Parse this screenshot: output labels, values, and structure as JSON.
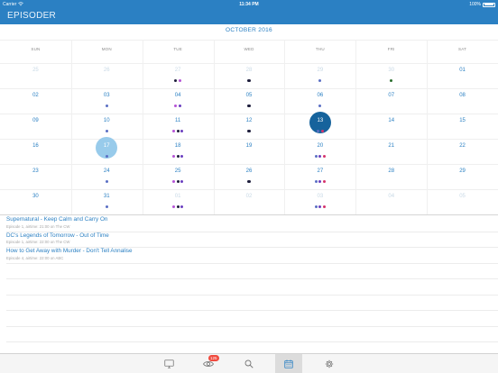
{
  "status_bar": {
    "carrier": "Carrier",
    "time": "11:34 PM",
    "battery": "100%"
  },
  "nav": {
    "title": "EPISODER"
  },
  "calendar": {
    "month_title": "OCTOBER 2016",
    "weekdays": [
      "SUN",
      "MON",
      "TUE",
      "WED",
      "THU",
      "FRI",
      "SAT"
    ],
    "weeks": [
      [
        {
          "n": "25",
          "other": true,
          "dots": []
        },
        {
          "n": "26",
          "other": true,
          "dots": []
        },
        {
          "n": "27",
          "other": true,
          "dots": [
            "#1e1e3c",
            "#b553d6"
          ]
        },
        {
          "n": "28",
          "other": true,
          "dots": [
            "#1e1e3c"
          ]
        },
        {
          "n": "29",
          "other": true,
          "dots": [
            "#5b6fc4"
          ]
        },
        {
          "n": "30",
          "other": true,
          "dots": [
            "#2b6e2e"
          ]
        },
        {
          "n": "01",
          "dots": []
        }
      ],
      [
        {
          "n": "02",
          "dots": []
        },
        {
          "n": "03",
          "dots": [
            "#5b6fc4"
          ]
        },
        {
          "n": "04",
          "dots": [
            "#b553d6",
            "#6a3fbf"
          ]
        },
        {
          "n": "05",
          "dots": [
            "#1e1e3c"
          ]
        },
        {
          "n": "06",
          "dots": [
            "#5b6fc4"
          ]
        },
        {
          "n": "07",
          "dots": []
        },
        {
          "n": "08",
          "dots": []
        }
      ],
      [
        {
          "n": "09",
          "dots": []
        },
        {
          "n": "10",
          "dots": [
            "#5b6fc4"
          ]
        },
        {
          "n": "11",
          "dots": [
            "#b553d6",
            "#1e1e3c",
            "#6a3fbf"
          ]
        },
        {
          "n": "12",
          "dots": [
            "#1e1e3c"
          ]
        },
        {
          "n": "13",
          "today": true,
          "dots": [
            "#5b6fc4",
            "#d6336c"
          ]
        },
        {
          "n": "14",
          "dots": []
        },
        {
          "n": "15",
          "dots": []
        }
      ],
      [
        {
          "n": "16",
          "dots": []
        },
        {
          "n": "17",
          "selected": true,
          "dots": [
            "#5b6fc4"
          ]
        },
        {
          "n": "18",
          "dots": [
            "#b553d6",
            "#1e1e3c",
            "#6a3fbf"
          ]
        },
        {
          "n": "19",
          "dots": []
        },
        {
          "n": "20",
          "dots": [
            "#5b6fc4",
            "#6a3fbf",
            "#d6336c"
          ]
        },
        {
          "n": "21",
          "dots": []
        },
        {
          "n": "22",
          "dots": []
        }
      ],
      [
        {
          "n": "23",
          "dots": []
        },
        {
          "n": "24",
          "dots": [
            "#5b6fc4"
          ]
        },
        {
          "n": "25",
          "dots": [
            "#b553d6",
            "#1e1e3c",
            "#6a3fbf"
          ]
        },
        {
          "n": "26",
          "dots": [
            "#1e1e3c"
          ]
        },
        {
          "n": "27",
          "dots": [
            "#5b6fc4",
            "#6a3fbf",
            "#d6336c"
          ]
        },
        {
          "n": "28",
          "dots": []
        },
        {
          "n": "29",
          "dots": []
        }
      ],
      [
        {
          "n": "30",
          "dots": []
        },
        {
          "n": "31",
          "dots": [
            "#5b6fc4"
          ]
        },
        {
          "n": "01",
          "other": true,
          "dots": [
            "#b553d6",
            "#1e1e3c",
            "#6a3fbf"
          ]
        },
        {
          "n": "02",
          "other": true,
          "dots": []
        },
        {
          "n": "03",
          "other": true,
          "dots": [
            "#5b6fc4",
            "#6a3fbf",
            "#d6336c"
          ]
        },
        {
          "n": "04",
          "other": true,
          "dots": []
        },
        {
          "n": "05",
          "other": true,
          "dots": []
        }
      ]
    ]
  },
  "episodes": [
    {
      "title": "Supernatural - Keep Calm and Carry On",
      "subtitle": "Episode 1, airtime: 21:00 on The CW"
    },
    {
      "title": "DC's Legends of Tomorrow - Out of Time",
      "subtitle": "Episode 1, airtime: 22:00 on The CW"
    },
    {
      "title": "How to Get Away with Murder - Don't Tell Annalise",
      "subtitle": "Episode 4, airtime: 22:00 on ABC"
    }
  ],
  "tabbar": {
    "tabs": [
      {
        "icon": "tv-icon"
      },
      {
        "icon": "eye-icon",
        "badge": "125"
      },
      {
        "icon": "search-icon"
      },
      {
        "icon": "calendar-icon",
        "active": true
      },
      {
        "icon": "gear-icon"
      }
    ]
  },
  "colors": {
    "accent": "#2b80c3",
    "today": "#16639c",
    "selected": "#98cbeb",
    "badge": "#f04a3e"
  }
}
